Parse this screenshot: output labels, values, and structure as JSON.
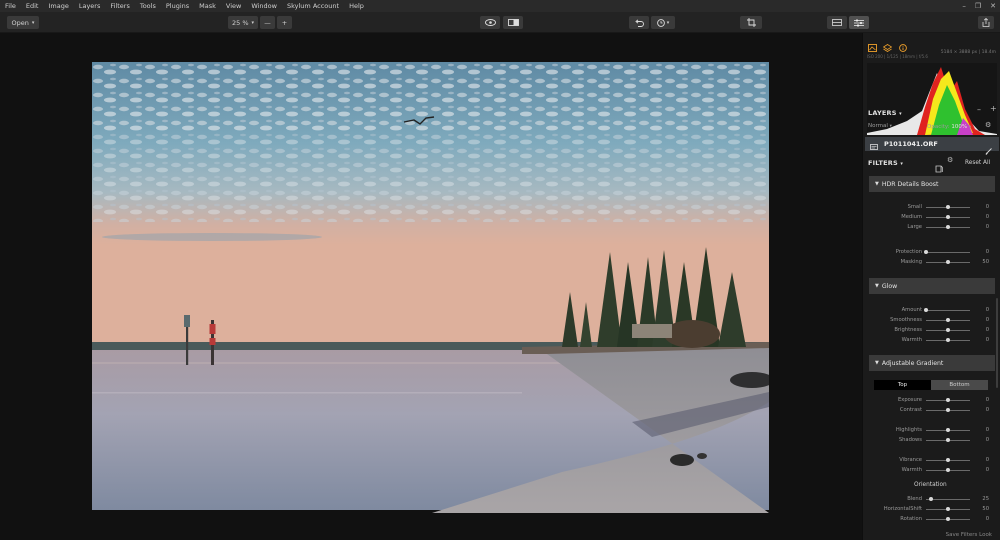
{
  "menu": [
    "File",
    "Edit",
    "Image",
    "Layers",
    "Filters",
    "Tools",
    "Plugins",
    "Mask",
    "View",
    "Window",
    "Skylum Account",
    "Help"
  ],
  "toolbar": {
    "open_label": "Open",
    "zoom_label": "25 %",
    "zoom_out_label": "—",
    "zoom_in_label": "+"
  },
  "image_meta": {
    "dimensions": "5184 × 3888 px  |  18.4m",
    "exif": "ISO 200  |  1/125  |  18mm  |  f/5.6"
  },
  "layers": {
    "title": "LAYERS",
    "blend_mode": "Normal",
    "opacity_label": "Opacity:",
    "opacity_value": "100%",
    "layer_name": "P1011041.ORF"
  },
  "filters": {
    "title": "FILTERS",
    "reset_all": "Reset All",
    "save_filters_look": "Save Filters Look",
    "cards": [
      {
        "name": "HDR Details Boost",
        "sliders": [
          {
            "label": "Small",
            "value": "0",
            "level": 0.5
          },
          {
            "label": "Medium",
            "value": "0",
            "level": 0.5
          },
          {
            "label": "Large",
            "value": "0",
            "level": 0.5
          },
          {
            "label": "Protection",
            "value": "0",
            "level": 0.0
          },
          {
            "label": "Masking",
            "value": "50",
            "level": 0.5
          }
        ]
      },
      {
        "name": "Glow",
        "sliders": [
          {
            "label": "Amount",
            "value": "0",
            "level": 0.0
          },
          {
            "label": "Smoothness",
            "value": "0",
            "level": 0.5
          },
          {
            "label": "Brightness",
            "value": "0",
            "level": 0.5
          },
          {
            "label": "Warmth",
            "value": "0",
            "level": 0.5
          }
        ]
      },
      {
        "name": "Adjustable Gradient",
        "toggle": [
          "Top",
          "Bottom"
        ],
        "toggle_active": "Top",
        "sliders": [
          {
            "label": "Exposure",
            "value": "0",
            "level": 0.5
          },
          {
            "label": "Contrast",
            "value": "0",
            "level": 0.5
          },
          {
            "label": "Highlights",
            "value": "0",
            "level": 0.5
          },
          {
            "label": "Shadows",
            "value": "0",
            "level": 0.5
          },
          {
            "label": "Vibrance",
            "value": "0",
            "level": 0.5
          },
          {
            "label": "Warmth",
            "value": "0",
            "level": 0.5
          }
        ],
        "orientation_title": "Orientation",
        "orientation_sliders": [
          {
            "label": "Blend",
            "value": "25",
            "level": 0.12
          },
          {
            "label": "HorizontalShift",
            "value": "50",
            "level": 0.5
          },
          {
            "label": "Rotation",
            "value": "0",
            "level": 0.5
          }
        ]
      }
    ]
  },
  "colors": {
    "accent": "#f0a12c",
    "active_toggle": "#000000",
    "inactive_toggle": "#4a4a4a"
  }
}
